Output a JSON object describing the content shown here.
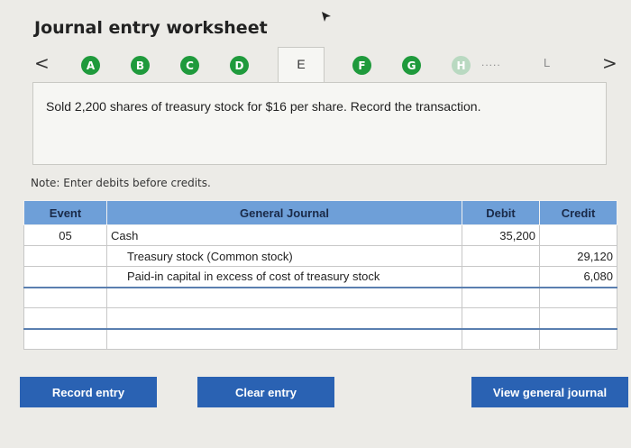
{
  "title": "Journal entry worksheet",
  "nav": {
    "prev": "<",
    "next": ">"
  },
  "tabs": [
    {
      "label": "A"
    },
    {
      "label": "B"
    },
    {
      "label": "C"
    },
    {
      "label": "D"
    },
    {
      "label": "E"
    },
    {
      "label": "F"
    },
    {
      "label": "G"
    },
    {
      "label": "H"
    },
    {
      "label": "....."
    },
    {
      "label": "L"
    }
  ],
  "question": "Sold 2,200 shares of treasury stock for $16 per share. Record the transaction.",
  "note": "Note: Enter debits before credits.",
  "table": {
    "headers": {
      "event": "Event",
      "journal": "General Journal",
      "debit": "Debit",
      "credit": "Credit"
    },
    "rows": [
      {
        "event": "05",
        "account": "Cash",
        "debit": "35,200",
        "credit": ""
      },
      {
        "event": "",
        "account": "Treasury stock (Common stock)",
        "debit": "",
        "credit": "29,120"
      },
      {
        "event": "",
        "account": "Paid-in capital in excess of cost of treasury stock",
        "debit": "",
        "credit": "6,080"
      },
      {
        "event": "",
        "account": "",
        "debit": "",
        "credit": ""
      },
      {
        "event": "",
        "account": "",
        "debit": "",
        "credit": ""
      },
      {
        "event": "",
        "account": "",
        "debit": "",
        "credit": ""
      }
    ]
  },
  "buttons": {
    "record": "Record entry",
    "clear": "Clear entry",
    "view": "View general journal"
  },
  "colors": {
    "tab_green": "#1f9a3c",
    "header_blue": "#6e9fd8",
    "button_blue": "#2a62b3"
  }
}
